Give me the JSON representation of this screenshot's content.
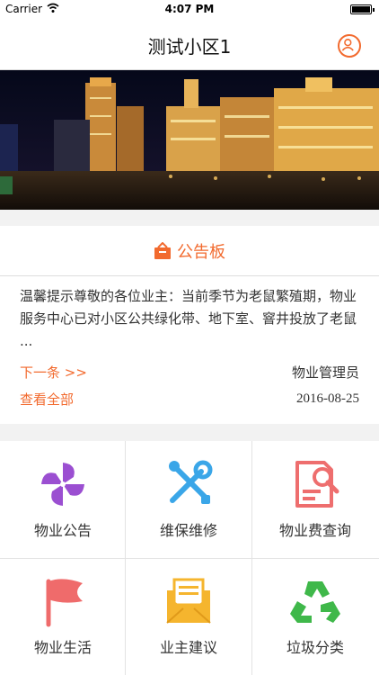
{
  "status_bar": {
    "carrier": "Carrier",
    "time": "4:07 PM"
  },
  "header": {
    "title": "测试小区1"
  },
  "notice_board": {
    "title": "公告板",
    "content": "温馨提示尊敬的各位业主：当前季节为老鼠繁殖期，物业服务中心已对小区公共绿化带、地下室、窨井投放了老鼠 ...",
    "next_label": "下一条 >>",
    "author": "物业管理员",
    "view_all_label": "查看全部",
    "date": "2016-08-25"
  },
  "menu": [
    {
      "label": "物业公告",
      "icon": "pinwheel-icon"
    },
    {
      "label": "维保维修",
      "icon": "tools-icon"
    },
    {
      "label": "物业费查询",
      "icon": "bill-search-icon"
    },
    {
      "label": "物业生活",
      "icon": "flag-icon"
    },
    {
      "label": "业主建议",
      "icon": "envelope-icon"
    },
    {
      "label": "垃圾分类",
      "icon": "recycle-icon"
    }
  ],
  "colors": {
    "accent": "#f26a2e"
  }
}
